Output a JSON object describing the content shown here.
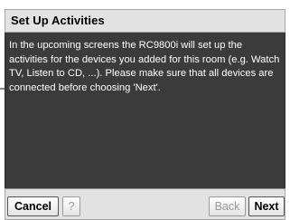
{
  "dialog": {
    "title": "Set Up Activities",
    "message": "In the upcoming screens the RC9800i will set up the activities for the devices you added for this room (e.g. Watch TV, Listen to CD, ...). Please make sure that all devices are connected before choosing 'Next'."
  },
  "buttons": {
    "cancel_label": "Cancel",
    "help_label": "?",
    "back_label": "Back",
    "next_label": "Next"
  },
  "colors": {
    "panel_background": "#3b3b3b",
    "bar_background": "#e2e2e2",
    "text_on_panel": "#ffffff",
    "disabled_text": "#9a9a9a"
  }
}
